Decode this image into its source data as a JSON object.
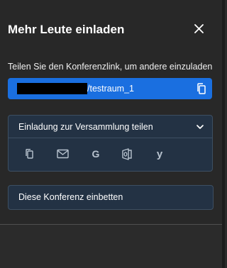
{
  "dialog": {
    "title": "Mehr Leute einladen",
    "subtitle": "Teilen Sie den Konferenzlink, um andere einzuladen",
    "link_suffix": "/testraum_1",
    "invite_section_label": "Einladung zur Versammlung teilen",
    "share_icons": [
      "copy-icon",
      "email-icon",
      "google-icon",
      "outlook-icon",
      "yahoo-icon"
    ],
    "embed_label": "Diese Konferenz einbetten"
  },
  "colors": {
    "background": "#282828",
    "accent": "#1a6fe0",
    "panel": "#233244",
    "panel_border": "#3d4f62",
    "icon": "#b8c3cf"
  }
}
